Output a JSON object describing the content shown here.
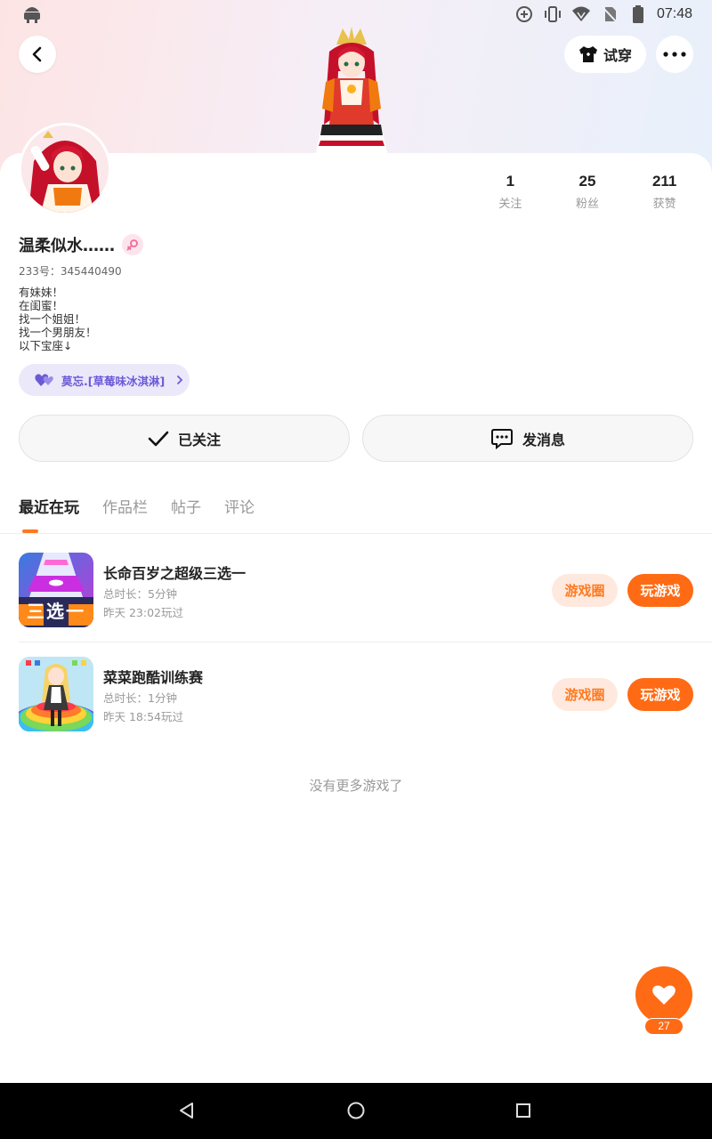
{
  "status_bar": {
    "time": "07:48",
    "icons": [
      "android-debug-icon",
      "data-saver-icon",
      "vibrate-icon",
      "wifi-icon",
      "no-sim-icon",
      "battery-icon"
    ]
  },
  "header": {
    "back_icon": "chevron-left-icon",
    "tryon_label": "试穿",
    "tryon_icon": "shirt-icon",
    "more_icon": "more-dots-icon"
  },
  "profile": {
    "stats": [
      {
        "value": "1",
        "label": "关注"
      },
      {
        "value": "25",
        "label": "粉丝"
      },
      {
        "value": "211",
        "label": "获赞"
      }
    ],
    "username": "温柔似水……",
    "gender_icon": "female-icon",
    "uid": "233号：345440490",
    "bio": [
      "有妹妹！",
      "在闺蜜！",
      "找一个姐姐！",
      "找一个男朋友！",
      "以下宝座↓"
    ],
    "couple_tag": "莫忘.[草莓味冰淇淋]"
  },
  "actions": {
    "follow_label": "已关注",
    "message_label": "发消息"
  },
  "tabs": [
    {
      "label": "最近在玩",
      "active": true
    },
    {
      "label": "作品栏",
      "active": false
    },
    {
      "label": "帖子",
      "active": false
    },
    {
      "label": "评论",
      "active": false
    }
  ],
  "games": [
    {
      "title": "长命百岁之超级三选一",
      "duration": "总时长：5分钟",
      "last_played": "昨天 23:02玩过",
      "thumb_text": "三选一",
      "circle_label": "游戏圈",
      "play_label": "玩游戏"
    },
    {
      "title": "菜菜跑酷训练赛",
      "duration": "总时长：1分钟",
      "last_played": "昨天 18:54玩过",
      "circle_label": "游戏圈",
      "play_label": "玩游戏"
    }
  ],
  "footer_text": "没有更多游戏了",
  "like_fab": {
    "count": "27",
    "icon": "heart-icon"
  },
  "colors": {
    "accent": "#ff6a14",
    "accent_light": "#ffe9de",
    "couple_tag_bg": "#ebe8fa",
    "couple_tag_text": "#6b5ad6"
  }
}
